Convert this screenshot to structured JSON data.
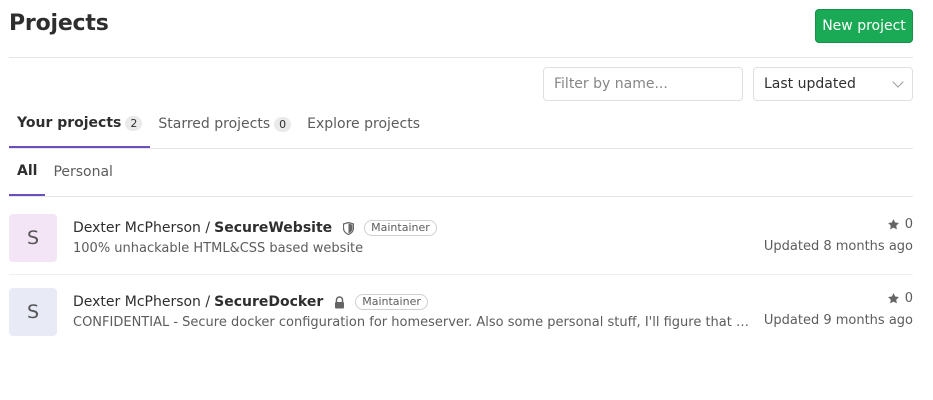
{
  "header": {
    "title": "Projects",
    "new_button": "New project"
  },
  "filters": {
    "search_placeholder": "Filter by name...",
    "sort_selected": "Last updated"
  },
  "tabs": [
    {
      "label": "Your projects",
      "count": "2"
    },
    {
      "label": "Starred projects",
      "count": "0"
    },
    {
      "label": "Explore projects"
    }
  ],
  "subtabs": [
    {
      "label": "All"
    },
    {
      "label": "Personal"
    }
  ],
  "projects": [
    {
      "avatar_letter": "S",
      "owner": "Dexter McPherson /",
      "name": "SecureWebsite",
      "visibility_icon": "shield-icon",
      "role": "Maintainer",
      "description": "100% unhackable HTML&CSS based website",
      "stars": "0",
      "updated": "Updated 8 months ago"
    },
    {
      "avatar_letter": "S",
      "owner": "Dexter McPherson /",
      "name": "SecureDocker",
      "visibility_icon": "lock-icon",
      "role": "Maintainer",
      "description": "CONFIDENTIAL - Secure docker configuration for homeserver. Also some personal stuff, I'll figure that out l...",
      "stars": "0",
      "updated": "Updated 9 months ago"
    }
  ],
  "colors": {
    "accent": "#6b4fbb",
    "success": "#1aaa55"
  }
}
